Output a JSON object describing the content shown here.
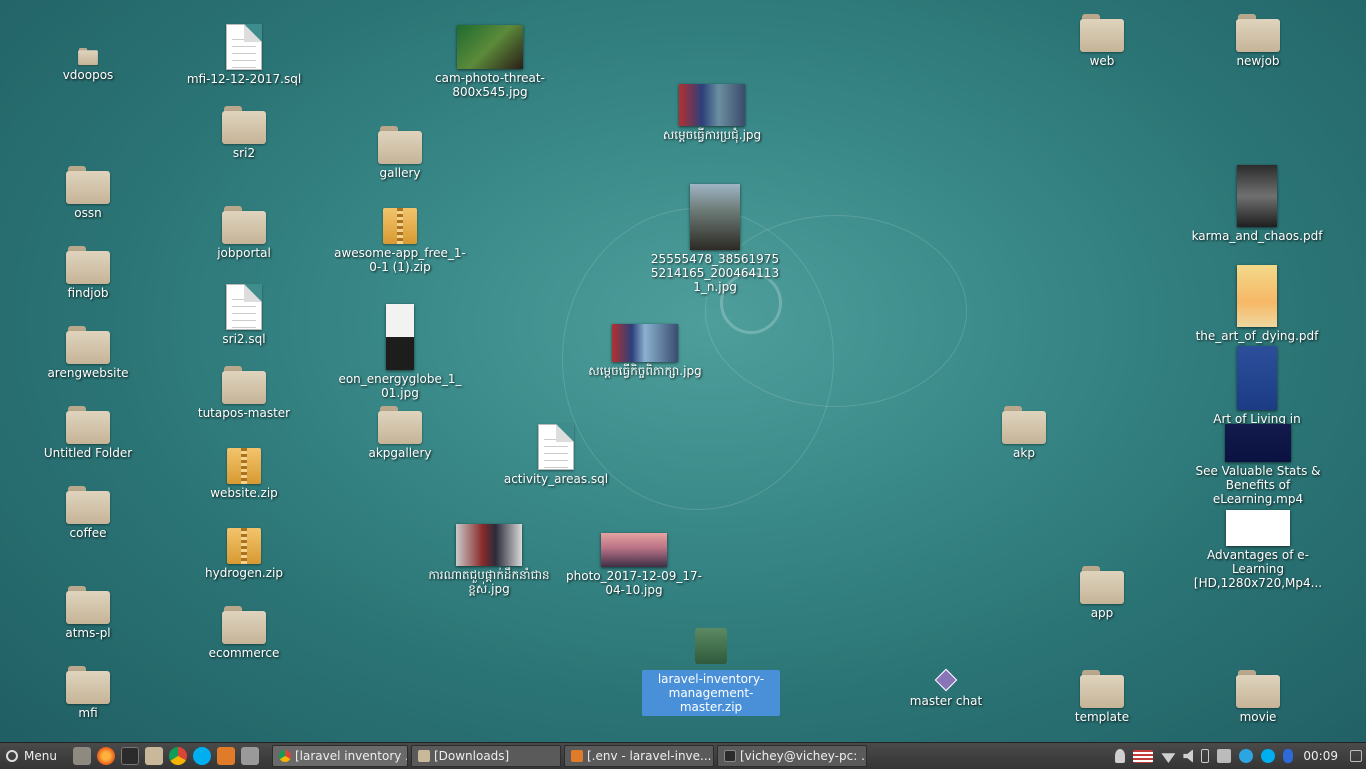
{
  "desktop": {
    "col1": [
      "vdoopos",
      "ossn",
      "findjob",
      "arengwebsite",
      "Untitled Folder",
      "coffee",
      "atms-pl",
      "mfi"
    ],
    "col2": {
      "mfi_sql": "mfi-12-12-2017.sql",
      "sri2": "sri2",
      "jobportal": "jobportal",
      "sri2_sql": "sri2.sql",
      "tutapos": "tutapos-master",
      "website_zip": "website.zip",
      "hydrogen_zip": "hydrogen.zip",
      "ecommerce": "ecommerce"
    },
    "col3": {
      "cam_photo": "cam-photo-threat-800x545.jpg",
      "gallery": "gallery",
      "awesome_zip": "awesome-app_free_1-0-1 (1).zip",
      "eon": "eon_energyglobe_1_01.jpg",
      "akpgallery": "akpgallery",
      "kh_photo3": "ការណាតជួបផ្តាក់ដឹកនាំជានខ្ពស់.jpg"
    },
    "center": {
      "kh_photo1": "សម្តេចធ្វើការប្រជុំ.jpg",
      "photo_2555": "25555478_385619755214165_2004641131_n.jpg",
      "kh_photo2": "សម្តេចធ្វើកិច្ចពិភាក្សា.jpg",
      "activity_sql": "activity_areas.sql",
      "photo_2017": "photo_2017-12-09_17-04-10.jpg",
      "laravel_zip": "laravel-inventory-management-master.zip",
      "master_chat": "master chat"
    },
    "right": {
      "web": "web",
      "newjob": "newjob",
      "karma_pdf": "karma_and_chaos.pdf",
      "art_dying": "the_art_of_dying.pdf",
      "art_living": "Art of Living in Er...",
      "akp": "akp",
      "elearning_mp4": "See Valuable Stats & Benefits of eLearning.mp4",
      "advantages": "Advantages of e-Learning [HD,1280x720,Mp4...",
      "app": "app",
      "template": "template",
      "movie": "movie"
    }
  },
  "taskbar": {
    "menu_label": "Menu",
    "tasks": [
      "[laravel inventory ...",
      "[Downloads]",
      "[.env - laravel-inve...",
      "[vichey@vichey-pc: ..."
    ],
    "clock": "00:09"
  },
  "colors": {
    "selection": "#4a90d9",
    "taskbar": "#3d3d3d",
    "desktop": "#3a8a89"
  }
}
